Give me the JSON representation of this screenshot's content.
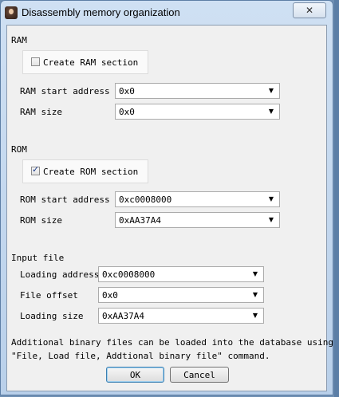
{
  "window": {
    "title": "Disassembly memory organization",
    "close_glyph": "✕"
  },
  "ram": {
    "section_label": "RAM",
    "checkbox_label": "Create RAM section",
    "checkbox_checked": false,
    "start_label": "RAM start address",
    "start_value": "0x0",
    "size_label": "RAM size",
    "size_value": "0x0"
  },
  "rom": {
    "section_label": "ROM",
    "checkbox_label": "Create ROM section",
    "checkbox_checked": true,
    "start_label": "ROM start address",
    "start_value": "0xc0008000",
    "size_label": "ROM size",
    "size_value": "0xAA37A4"
  },
  "input_file": {
    "section_label": "Input file",
    "loading_address_label": "Loading address",
    "loading_address_value": "0xc0008000",
    "file_offset_label": "File offset",
    "file_offset_value": "0x0",
    "loading_size_label": "Loading size",
    "loading_size_value": "0xAA37A4"
  },
  "note": {
    "line1": "Additional binary files can be loaded into the database using the",
    "line2": "\"File, Load file, Addtional binary file\" command."
  },
  "buttons": {
    "ok": "OK",
    "cancel": "Cancel"
  },
  "icons": {
    "dropdown": "chevron-down-icon",
    "check": "checkmark-icon",
    "app": "app-icon",
    "close": "close-icon"
  }
}
